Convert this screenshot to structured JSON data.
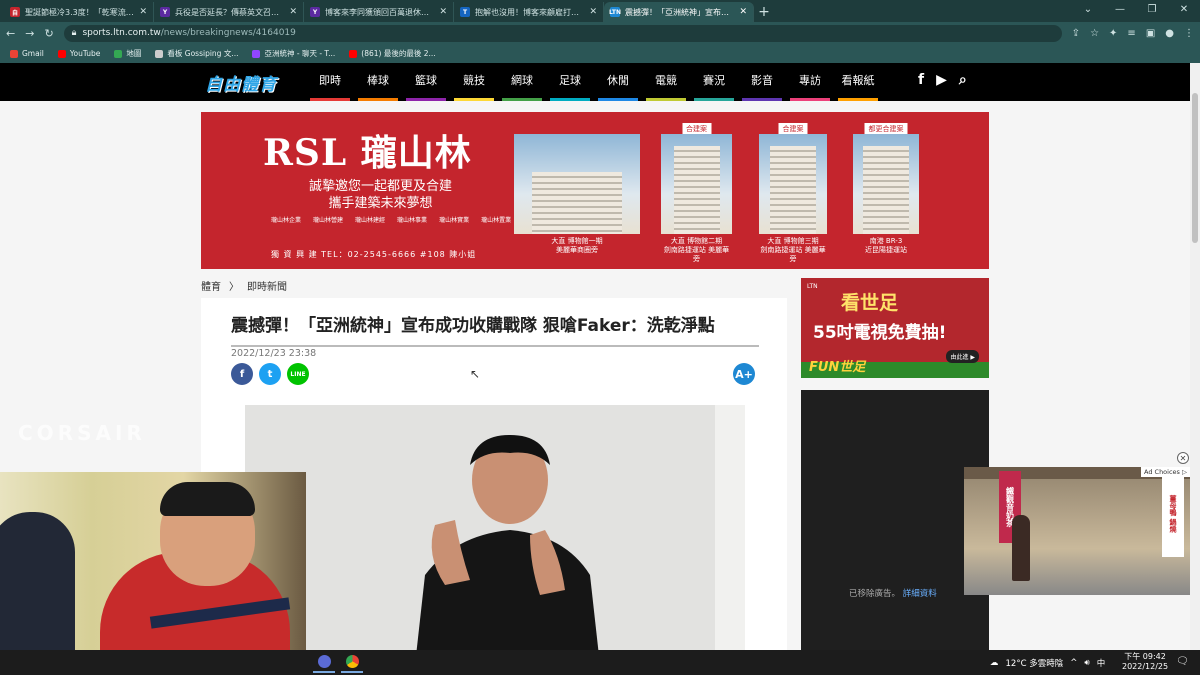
{
  "browser": {
    "tabs": [
      {
        "label": "聖誕節極冷3.3度！「乾寒流」明",
        "fav_color": "#c4252d",
        "fav_text": "自"
      },
      {
        "label": "兵役是否延長？傳蔡英文召開國家",
        "fav_color": "#5b2aa0",
        "fav_text": "Y"
      },
      {
        "label": "博客來李同獲頒回百萬退休金 網",
        "fav_color": "#5b2aa0",
        "fav_text": "Y"
      },
      {
        "label": "抱解也沒用！博客來顧雇打錄20",
        "fav_color": "#1565c0",
        "fav_text": "T"
      },
      {
        "label": "震撼彈！「亞洲統神」宣布成功",
        "fav_color": "#1e88d3",
        "fav_text": "LTN",
        "active": true
      }
    ],
    "url_host": "sports.ltn.com.tw",
    "url_path": "/news/breakingnews/4164019",
    "bookmarks": [
      {
        "label": "Gmail",
        "color": "#ea4335"
      },
      {
        "label": "YouTube",
        "color": "#ff0000"
      },
      {
        "label": "地圖",
        "color": "#34a853"
      },
      {
        "label": "看板 Gossiping 文...",
        "color": "#cccccc"
      },
      {
        "label": "亞洲統神 - 聊天 - T...",
        "color": "#9146ff"
      },
      {
        "label": "(861) 最後的最後 2...",
        "color": "#ff0000"
      }
    ]
  },
  "site": {
    "logo": "自由體育",
    "menu": [
      {
        "label": "即時",
        "color": "#e53935"
      },
      {
        "label": "棒球",
        "color": "#f57c00"
      },
      {
        "label": "籃球",
        "color": "#8e24aa"
      },
      {
        "label": "競技",
        "color": "#fdd835"
      },
      {
        "label": "網球",
        "color": "#43a047"
      },
      {
        "label": "足球",
        "color": "#00acc1"
      },
      {
        "label": "休閒",
        "color": "#1e88e5"
      },
      {
        "label": "電競",
        "color": "#c0ca33"
      },
      {
        "label": "賽況",
        "color": "#26a69a"
      },
      {
        "label": "影音",
        "color": "#5e35b1"
      },
      {
        "label": "專訪",
        "color": "#ec407a"
      },
      {
        "label": "看報紙",
        "color": "#ffa000"
      }
    ]
  },
  "banner": {
    "brand": "RSL 瓏山林",
    "slogan_1": "誠摯邀您一起都更及合建",
    "slogan_2": "攜手建築未來夢想",
    "partners": [
      "瓏山林企業",
      "瓏山林營建",
      "瓏山林建經",
      "瓏山林事業",
      "瓏山林實業",
      "瓏山林置業"
    ],
    "tel": "獨 資 興 建    TEL：02-2545-6666 #108 陳小姐",
    "projects": [
      {
        "tag": "",
        "cap1": "大直 博物館一期",
        "cap2": "美麗華商圈旁"
      },
      {
        "tag": "合建案",
        "cap1": "大直 博物館二期",
        "cap2": "劍南路捷運站 美麗華旁"
      },
      {
        "tag": "合建案",
        "cap1": "大直 博物館三期",
        "cap2": "劍南路捷運站 美麗華旁"
      },
      {
        "tag": "都更合建案",
        "cap1": "南港 BR-3",
        "cap2": "近昆陽捷運站"
      }
    ]
  },
  "breadcrumb": {
    "root": "體育",
    "sep": "〉",
    "current": "即時新聞"
  },
  "article": {
    "title": "震撼彈！「亞洲統神」宣布成功收購戰隊 狠嗆Faker：洗乾淨點",
    "date": "2022/12/23 23:38",
    "font_button": "A+"
  },
  "share": {
    "facebook": "f",
    "twitter": "t",
    "line": "LINE"
  },
  "side_ad": {
    "top": "看世足",
    "mid": "55吋電視免費抽!",
    "fun": "FUN世足",
    "ltn": "LTN",
    "btn": "由此進 ▶"
  },
  "side_dark": {
    "removed": "已移除廣告。",
    "details": "詳細資料"
  },
  "video_ad": {
    "adchoices": "Ad Choices ▷",
    "sign_left": "鐵觀音奶茶",
    "sign_right": "薑母鴨 鍋燒"
  },
  "watermark": "CORSAIR",
  "taskbar": {
    "weather": "12°C 多雲時陰",
    "ime": "中",
    "time": "下午 09:42",
    "date": "2022/12/25"
  }
}
